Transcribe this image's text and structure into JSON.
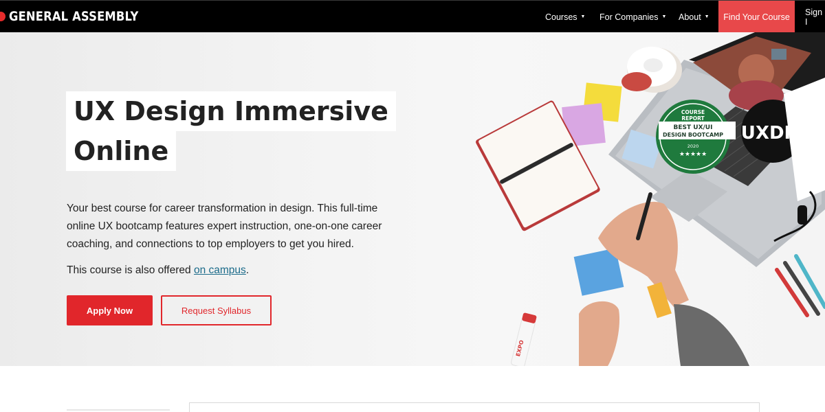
{
  "nav": {
    "logo_text": "GENERAL ASSEMBLY",
    "links": [
      {
        "label": "Courses"
      },
      {
        "label": "For Companies"
      },
      {
        "label": "About"
      }
    ],
    "cta_label": "Find Your Course",
    "sign_in_label": "Sign I"
  },
  "hero": {
    "title_line1": "UX Design Immersive",
    "title_line2": "Online",
    "description": "Your best course for career transformation in design. This full-time online UX bootcamp features expert instruction, one-on-one career coaching, and connections to top employers to get you hired.",
    "campus_prefix": "This course is also offered ",
    "campus_link": "on campus",
    "campus_suffix": ".",
    "apply_label": "Apply Now",
    "syllabus_label": "Request Syllabus"
  },
  "image": {
    "badge_top": "COURSE",
    "badge_top2": "REPORT",
    "badge_ribbon1": "BEST UX/UI",
    "badge_ribbon2": "DESIGN BOOTCAMP",
    "badge_year": "2020",
    "badge_stars": "★★★★★",
    "sticker_text": "UXDIR",
    "marker_text": "EXPO"
  },
  "colors": {
    "accent": "#e1262b",
    "nav_cta": "#e8484a",
    "link": "#1b6b8a",
    "badge_green": "#1f7a3d"
  }
}
